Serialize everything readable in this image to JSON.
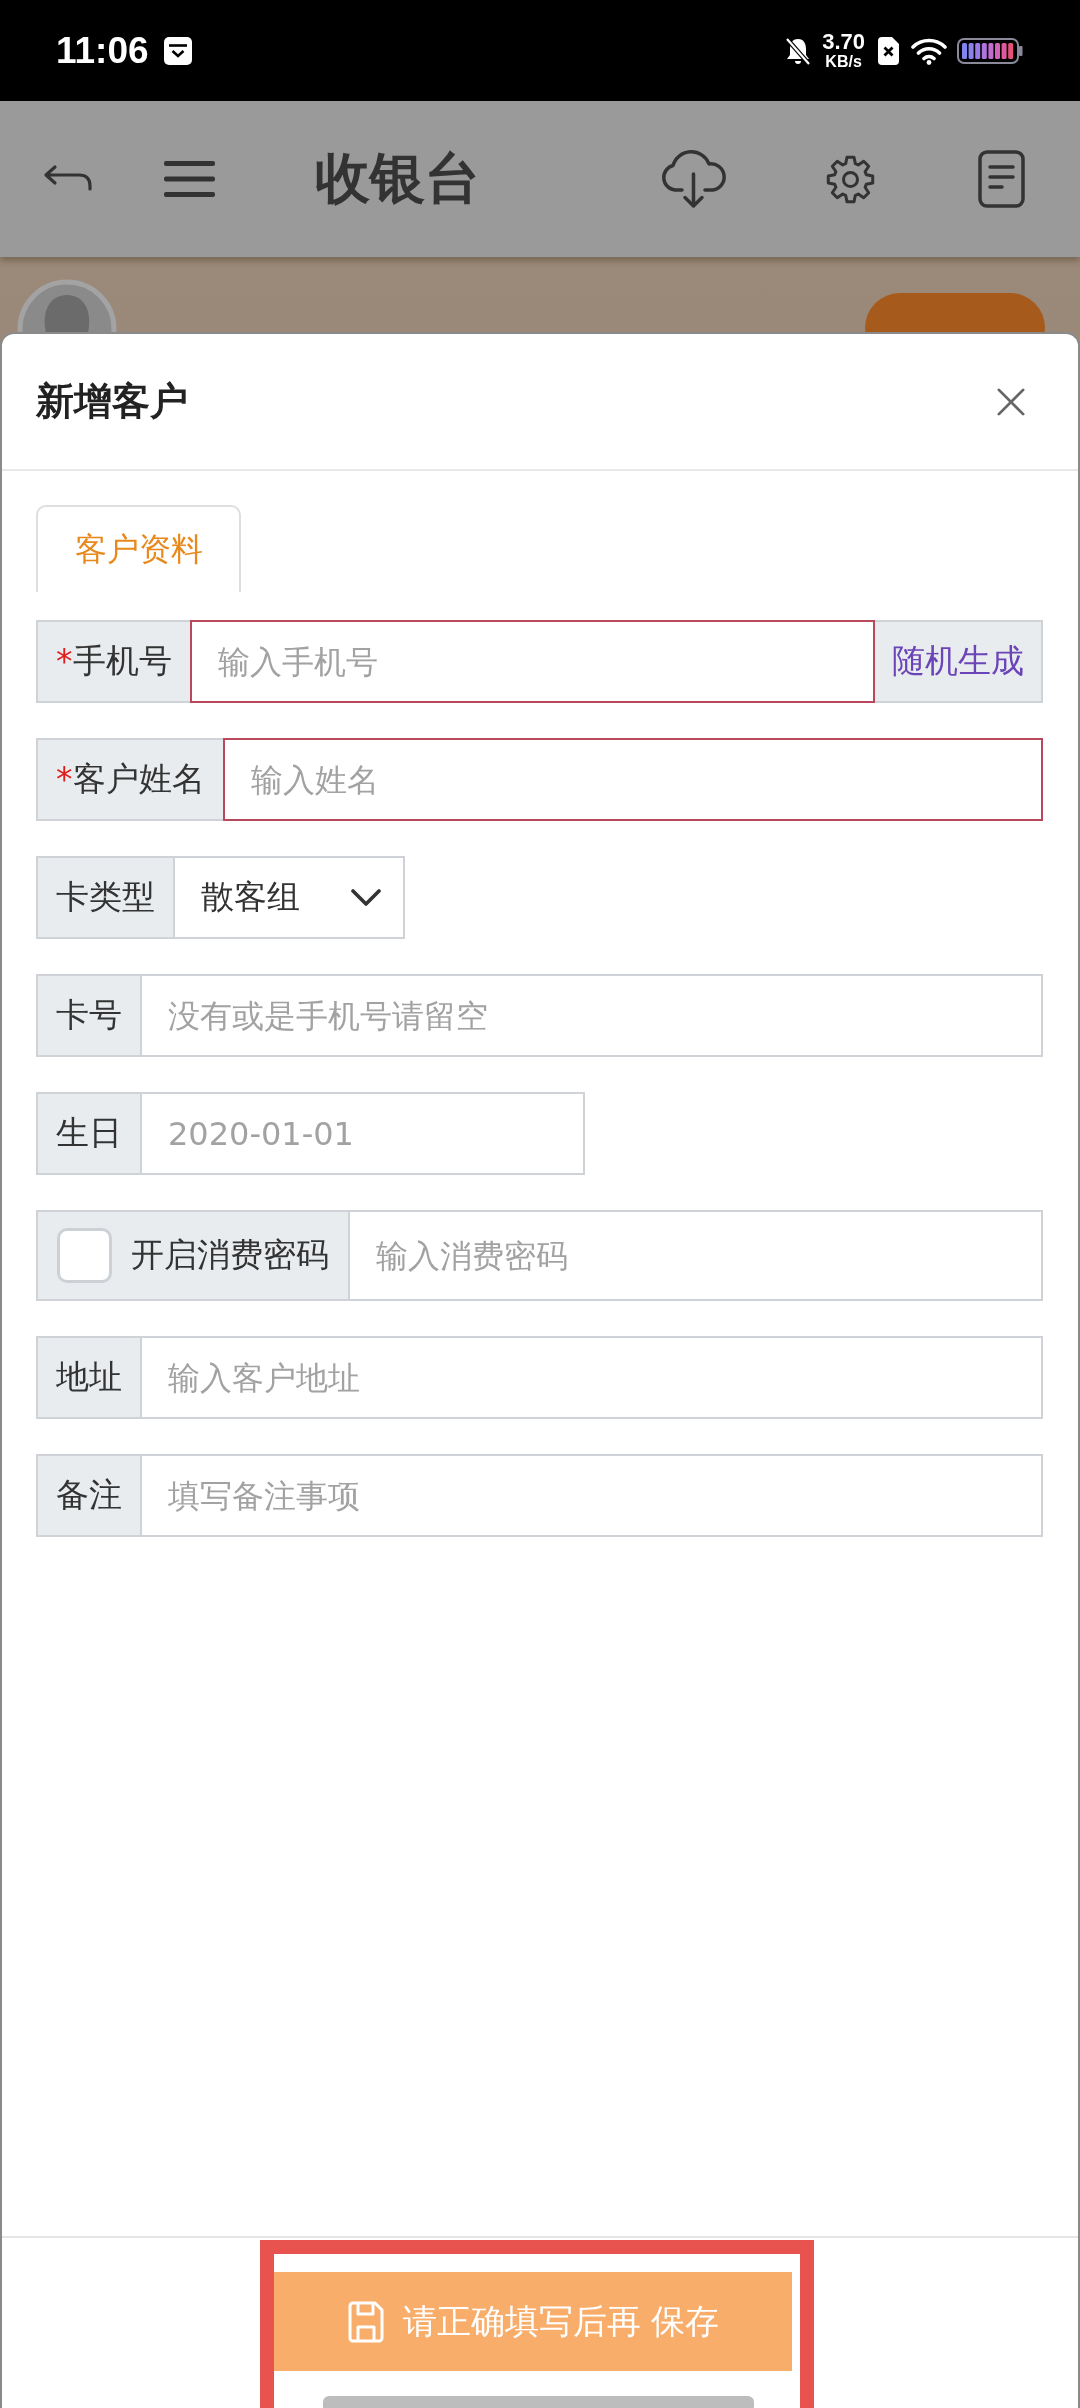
{
  "status_bar": {
    "time": "11:06",
    "speed": "3.70",
    "speed_unit": "KB/s"
  },
  "app_bar": {
    "title": "收银台"
  },
  "dialog": {
    "title": "新增客户",
    "tabs": [
      {
        "label": "客户资料",
        "selected": true
      }
    ],
    "fields": [
      {
        "kind": "text",
        "required_mark": "*",
        "label": "手机号",
        "placeholder": "输入手机号",
        "action": "随机生成",
        "invalid": true
      },
      {
        "kind": "text",
        "required_mark": "*",
        "label": "客户姓名",
        "placeholder": "输入姓名",
        "invalid": true
      },
      {
        "kind": "select",
        "label": "卡类型",
        "value": "散客组",
        "invalid": false
      },
      {
        "kind": "text",
        "label": "卡号",
        "placeholder": "没有或是手机号请留空",
        "invalid": false
      },
      {
        "kind": "date",
        "label": "生日",
        "placeholder": "2020-01-01",
        "invalid": false
      },
      {
        "kind": "toggle",
        "label": "开启消费密码",
        "checked": false,
        "placeholder": "输入消费密码",
        "invalid": false
      },
      {
        "kind": "text",
        "label": "地址",
        "placeholder": "输入客户地址",
        "invalid": false
      },
      {
        "kind": "text",
        "label": "备注",
        "placeholder": "填写备注事项",
        "invalid": false
      }
    ],
    "save_button": {
      "label": "请正确填写后再 保存",
      "disabled": true
    }
  }
}
